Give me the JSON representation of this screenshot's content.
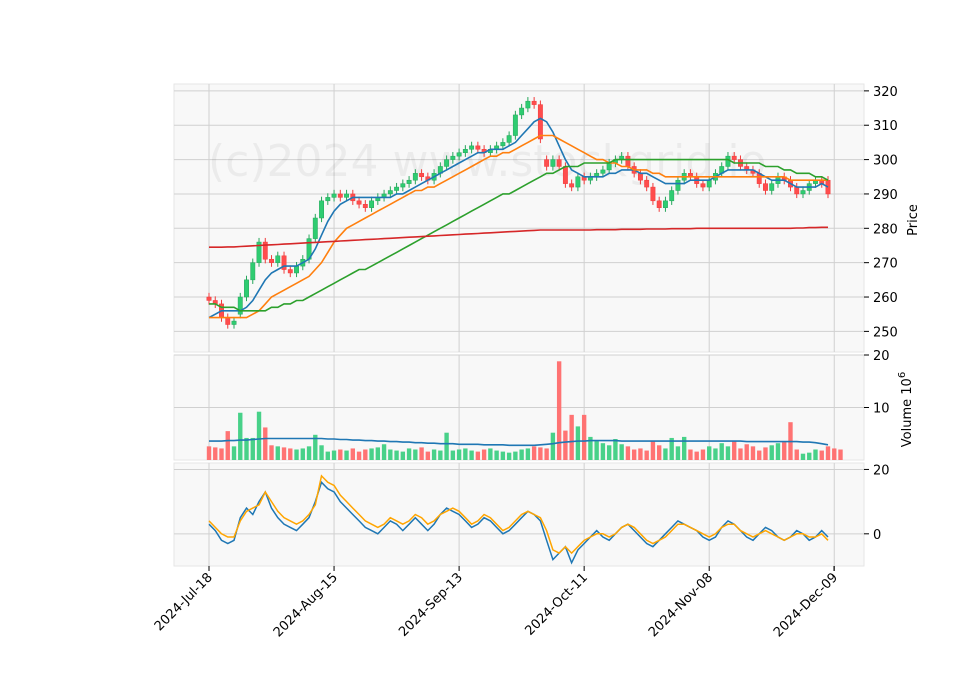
{
  "watermark": "(c)2024 www.stockgrid.io",
  "chart_data": {
    "type": "candlestick",
    "title": "",
    "x_tick_labels": [
      "2024-Jul-18",
      "2024-Aug-15",
      "2024-Sep-13",
      "2024-Oct-11",
      "2024-Nov-08",
      "2024-Dec-09"
    ],
    "x_tick_indices": [
      0,
      20,
      40,
      60,
      80,
      100
    ],
    "price_panel": {
      "ylabel": "Price",
      "ylim": [
        244,
        322
      ],
      "yticks": [
        250,
        260,
        270,
        280,
        290,
        300,
        310,
        320
      ],
      "grid": true,
      "close": [
        259,
        258,
        254,
        252,
        253,
        260,
        265,
        270,
        276,
        271,
        270,
        272,
        268,
        267,
        269,
        271,
        277,
        283,
        288,
        289,
        290,
        289,
        290,
        288,
        287,
        286,
        288,
        289,
        290,
        291,
        292,
        293,
        294,
        296,
        295,
        294,
        296,
        298,
        300,
        301,
        302,
        303,
        304,
        303,
        302,
        303,
        304,
        305,
        307,
        313,
        315,
        317,
        316,
        306,
        298,
        300,
        298,
        293,
        292,
        295,
        294,
        295,
        296,
        297,
        299,
        300,
        301,
        298,
        296,
        294,
        292,
        288,
        286,
        288,
        291,
        294,
        296,
        295,
        293,
        292,
        294,
        296,
        298,
        301,
        300,
        298,
        297,
        296,
        293,
        291,
        293,
        295,
        294,
        292,
        290,
        291,
        293,
        294,
        293,
        290
      ],
      "open": [
        260,
        259,
        258,
        254,
        252,
        255,
        260,
        265,
        270,
        276,
        271,
        270,
        272,
        268,
        267,
        269,
        271,
        277,
        283,
        288,
        289,
        290,
        289,
        290,
        288,
        287,
        286,
        288,
        289,
        290,
        291,
        292,
        293,
        294,
        296,
        295,
        294,
        296,
        298,
        300,
        301,
        302,
        303,
        304,
        303,
        302,
        303,
        304,
        305,
        307,
        313,
        315,
        317,
        316,
        300,
        298,
        300,
        298,
        293,
        292,
        295,
        294,
        295,
        296,
        297,
        299,
        300,
        301,
        298,
        296,
        294,
        292,
        288,
        286,
        288,
        291,
        294,
        296,
        295,
        293,
        292,
        294,
        296,
        298,
        301,
        300,
        298,
        297,
        296,
        293,
        291,
        293,
        295,
        294,
        292,
        290,
        291,
        293,
        294,
        294
      ],
      "ma_lines": [
        {
          "color": "#1f77b4",
          "values": [
            254,
            255,
            256,
            256,
            256,
            256,
            257,
            259,
            262,
            265,
            267,
            268,
            269,
            269,
            269,
            270,
            271,
            274,
            278,
            282,
            285,
            287,
            288,
            289,
            289,
            289,
            289,
            289,
            289,
            289,
            290,
            290,
            291,
            292,
            293,
            294,
            295,
            296,
            297,
            298,
            299,
            300,
            301,
            302,
            302,
            303,
            303,
            303,
            304,
            305,
            307,
            309,
            311,
            312,
            311,
            308,
            304,
            300,
            297,
            296,
            295,
            295,
            295,
            295,
            296,
            296,
            297,
            297,
            297,
            296,
            296,
            295,
            294,
            293,
            293,
            293,
            293,
            294,
            294,
            294,
            294,
            295,
            296,
            297,
            297,
            297,
            297,
            297,
            296,
            295,
            294,
            294,
            294,
            293,
            292,
            292,
            292,
            292,
            293,
            292
          ]
        },
        {
          "color": "#ff7f0e",
          "values": [
            254,
            254,
            254,
            254,
            254,
            254,
            254,
            255,
            256,
            258,
            260,
            261,
            262,
            263,
            264,
            265,
            266,
            268,
            270,
            273,
            276,
            278,
            280,
            281,
            282,
            283,
            284,
            285,
            286,
            287,
            288,
            289,
            290,
            291,
            291,
            292,
            292,
            293,
            294,
            295,
            296,
            297,
            298,
            299,
            300,
            301,
            301,
            302,
            302,
            303,
            304,
            305,
            306,
            307,
            307,
            307,
            306,
            305,
            304,
            303,
            302,
            301,
            300,
            300,
            299,
            299,
            298,
            298,
            297,
            297,
            297,
            296,
            296,
            295,
            295,
            295,
            295,
            295,
            295,
            295,
            295,
            295,
            295,
            295,
            295,
            295,
            295,
            295,
            295,
            295,
            295,
            295,
            295,
            294,
            294,
            294,
            294,
            294,
            294,
            294
          ]
        },
        {
          "color": "#2ca02c",
          "values": [
            258,
            258,
            257,
            257,
            257,
            256,
            256,
            256,
            256,
            256,
            257,
            257,
            258,
            258,
            259,
            259,
            260,
            261,
            262,
            263,
            264,
            265,
            266,
            267,
            268,
            268,
            269,
            270,
            271,
            272,
            273,
            274,
            275,
            276,
            277,
            278,
            279,
            280,
            281,
            282,
            283,
            284,
            285,
            286,
            287,
            288,
            289,
            290,
            290,
            291,
            292,
            293,
            294,
            295,
            296,
            296,
            297,
            298,
            298,
            298,
            299,
            299,
            299,
            299,
            299,
            300,
            300,
            300,
            300,
            300,
            300,
            300,
            300,
            300,
            300,
            300,
            300,
            300,
            300,
            300,
            300,
            300,
            300,
            300,
            299,
            299,
            299,
            299,
            299,
            298,
            298,
            298,
            297,
            297,
            296,
            296,
            296,
            295,
            295,
            294
          ]
        },
        {
          "color": "#d62728",
          "values": [
            274.5,
            274.5,
            274.5,
            274.6,
            274.6,
            274.7,
            274.8,
            274.9,
            275.0,
            275.1,
            275.2,
            275.3,
            275.4,
            275.5,
            275.6,
            275.7,
            275.8,
            275.9,
            276.0,
            276.1,
            276.2,
            276.3,
            276.4,
            276.5,
            276.6,
            276.7,
            276.8,
            276.9,
            277.0,
            277.1,
            277.2,
            277.3,
            277.4,
            277.5,
            277.6,
            277.7,
            277.8,
            277.9,
            278.0,
            278.1,
            278.2,
            278.3,
            278.4,
            278.5,
            278.6,
            278.7,
            278.8,
            278.9,
            279.0,
            279.1,
            279.2,
            279.3,
            279.4,
            279.5,
            279.5,
            279.5,
            279.5,
            279.5,
            279.5,
            279.5,
            279.5,
            279.5,
            279.6,
            279.6,
            279.6,
            279.6,
            279.7,
            279.7,
            279.7,
            279.7,
            279.8,
            279.8,
            279.8,
            279.8,
            279.9,
            279.9,
            279.9,
            279.9,
            280.0,
            280.0,
            280.0,
            280.0,
            280.0,
            280.0,
            280.0,
            280.0,
            280.0,
            280.0,
            280.0,
            280.0,
            280.0,
            280.0,
            280.0,
            280.0,
            280.1,
            280.1,
            280.2,
            280.2,
            280.3,
            280.3
          ]
        }
      ]
    },
    "volume_panel": {
      "ylabel": "Volume  10^6",
      "ylim": [
        0,
        20
      ],
      "yticks": [
        10,
        20
      ],
      "volume": [
        2.6,
        2.4,
        2.2,
        5.5,
        2.6,
        9.0,
        4.2,
        4.2,
        9.2,
        6.2,
        2.8,
        2.6,
        2.4,
        2.2,
        2.0,
        2.2,
        2.6,
        4.8,
        2.8,
        1.6,
        1.8,
        2.0,
        1.8,
        2.2,
        1.6,
        2.0,
        2.2,
        2.4,
        3.0,
        2.0,
        1.8,
        1.6,
        2.2,
        2.0,
        2.4,
        1.6,
        2.0,
        1.8,
        5.2,
        1.8,
        2.0,
        2.2,
        1.8,
        1.6,
        2.0,
        2.2,
        1.8,
        1.6,
        1.4,
        1.6,
        2.0,
        2.2,
        2.6,
        2.4,
        2.2,
        5.2,
        18.8,
        5.6,
        8.6,
        6.4,
        8.6,
        4.4,
        3.6,
        3.2,
        2.8,
        4.0,
        3.0,
        2.6,
        2.0,
        2.2,
        1.8,
        3.6,
        2.8,
        2.2,
        4.2,
        2.6,
        4.4,
        2.0,
        1.6,
        2.0,
        2.6,
        2.2,
        3.2,
        2.6,
        3.6,
        2.2,
        3.0,
        2.6,
        1.8,
        2.4,
        2.8,
        3.2,
        3.4,
        7.2,
        2.0,
        1.2,
        1.4,
        2.0,
        1.8,
        2.6,
        2.2,
        2.0
      ],
      "avg_line": [
        3.6,
        3.6,
        3.6,
        3.7,
        3.7,
        3.8,
        3.8,
        3.9,
        4.0,
        4.1,
        4.1,
        4.1,
        4.1,
        4.1,
        4.1,
        4.1,
        4.1,
        4.1,
        4.1,
        4.0,
        4.0,
        3.9,
        3.9,
        3.8,
        3.8,
        3.7,
        3.7,
        3.6,
        3.6,
        3.5,
        3.5,
        3.4,
        3.4,
        3.3,
        3.3,
        3.2,
        3.2,
        3.1,
        3.1,
        3.1,
        3.0,
        3.0,
        3.0,
        3.0,
        2.9,
        2.9,
        2.9,
        2.9,
        2.8,
        2.8,
        2.8,
        2.8,
        2.8,
        2.9,
        3.0,
        3.1,
        3.3,
        3.4,
        3.5,
        3.6,
        3.6,
        3.7,
        3.7,
        3.7,
        3.7,
        3.7,
        3.6,
        3.6,
        3.6,
        3.6,
        3.6,
        3.6,
        3.6,
        3.6,
        3.6,
        3.6,
        3.6,
        3.6,
        3.6,
        3.6,
        3.6,
        3.6,
        3.6,
        3.6,
        3.6,
        3.6,
        3.5,
        3.5,
        3.5,
        3.5,
        3.5,
        3.5,
        3.5,
        3.5,
        3.5,
        3.4,
        3.4,
        3.3,
        3.1,
        2.9
      ]
    },
    "oscillator_panel": {
      "ylim": [
        -10,
        22
      ],
      "yticks": [
        0,
        20
      ],
      "series": [
        {
          "color": "#1f77b4",
          "values": [
            3,
            1,
            -2,
            -3,
            -2,
            5,
            8,
            6,
            10,
            13,
            8,
            5,
            3,
            2,
            1,
            3,
            5,
            10,
            16,
            14,
            13,
            10,
            8,
            6,
            4,
            2,
            1,
            0,
            2,
            4,
            3,
            1,
            3,
            5,
            3,
            1,
            3,
            6,
            8,
            7,
            6,
            4,
            2,
            3,
            5,
            4,
            2,
            0,
            1,
            3,
            5,
            7,
            6,
            4,
            -2,
            -8,
            -6,
            -4,
            -9,
            -5,
            -3,
            -1,
            1,
            -1,
            -2,
            0,
            2,
            3,
            1,
            -1,
            -3,
            -4,
            -2,
            0,
            2,
            4,
            3,
            2,
            1,
            -1,
            -2,
            -1,
            2,
            4,
            3,
            1,
            -1,
            -2,
            0,
            2,
            1,
            -1,
            -2,
            -1,
            1,
            0,
            -2,
            -1,
            1,
            -1
          ]
        },
        {
          "color": "#ffa500",
          "values": [
            4,
            2,
            0,
            -1,
            -1,
            4,
            7,
            8,
            9,
            13,
            10,
            7,
            5,
            4,
            3,
            4,
            6,
            9,
            18,
            16,
            15,
            12,
            10,
            8,
            6,
            4,
            3,
            2,
            3,
            5,
            4,
            3,
            4,
            6,
            5,
            3,
            4,
            6,
            7,
            8,
            7,
            5,
            3,
            4,
            6,
            5,
            3,
            1,
            2,
            4,
            6,
            7,
            6,
            5,
            1,
            -5,
            -6,
            -4,
            -6,
            -4,
            -2,
            -1,
            0,
            0,
            -1,
            0,
            2,
            3,
            2,
            0,
            -2,
            -3,
            -2,
            -1,
            1,
            3,
            3,
            2,
            1,
            0,
            -1,
            0,
            2,
            3,
            3,
            1,
            0,
            -1,
            0,
            1,
            0,
            -1,
            -2,
            -1,
            0,
            0,
            -1,
            -1,
            0,
            -2
          ]
        }
      ]
    }
  }
}
